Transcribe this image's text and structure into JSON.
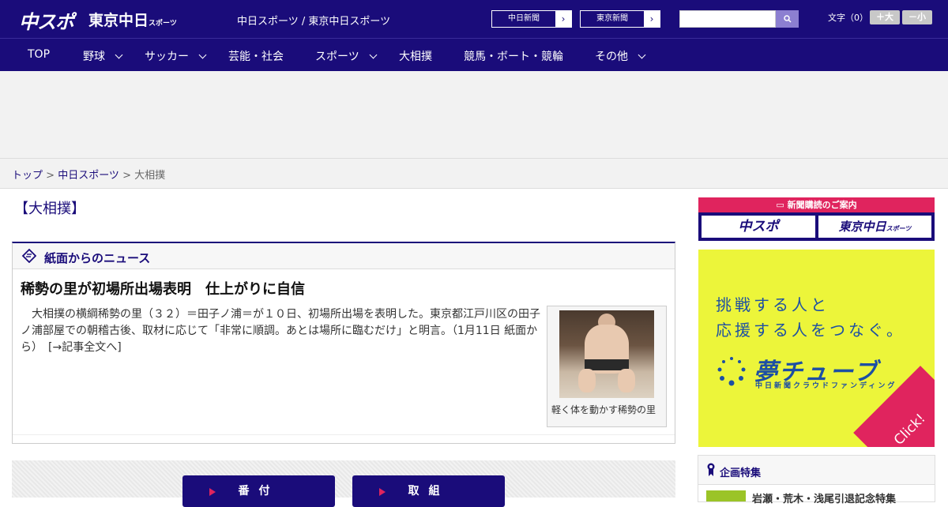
{
  "header": {
    "logo_chunichi": "中スポ",
    "logo_tokyo": "東京中日",
    "logo_tokyo_small": "スポーツ",
    "site_title": "中日スポーツ / 東京中日スポーツ",
    "link_chunichi": "中日新聞",
    "link_tokyo": "東京新聞",
    "search_placeholder": "",
    "fontsize_label": "文字（0）",
    "fontsize_plus": "＋大",
    "fontsize_minus": "－小"
  },
  "nav": {
    "items": [
      {
        "label": "TOP"
      },
      {
        "label": "野球"
      },
      {
        "label": "サッカー"
      },
      {
        "label": "芸能・社会"
      },
      {
        "label": "スポーツ"
      },
      {
        "label": "大相撲"
      },
      {
        "label": "競馬・ボート・競輪"
      },
      {
        "label": "その他"
      }
    ]
  },
  "breadcrumb": {
    "home": "トップ",
    "sep": " > ",
    "parent": "中日スポーツ",
    "current": "大相撲"
  },
  "section_title": "【大相撲】",
  "news": {
    "box_title": "紙面からのニュース",
    "headline": "稀勢の里が初場所出場表明　仕上がりに自信",
    "body": "大相撲の横綱稀勢の里（３２）＝田子ノ浦＝が１０日、初場所出場を表明した。東京都江戸川区の田子ノ浦部屋での朝稽古後、取材に応じて「非常に順調。あとは場所に臨むだけ」と明言。（1月11日 紙面から）　",
    "more_link": "[→記事全文へ]",
    "photo_caption": "軽く体を動かす稀勢の里"
  },
  "bottom_buttons": {
    "banzuke": "番付",
    "torikumi": "取組"
  },
  "sidebar": {
    "subscribe_title": "新聞購読のご案内",
    "subscribe_logo_a": "中スポ",
    "subscribe_logo_b": "東京中日",
    "subscribe_logo_b_small": "スポーツ",
    "ad_line1": "挑戦する人と",
    "ad_line2": "応援する人をつなぐ。",
    "ad_brand": "夢チューブ",
    "ad_brand_sub": "中日新聞クラウドファンディング",
    "ad_click": "Click!",
    "feature_title": "企画特集",
    "feature_item": "岩瀬・荒木・浅尾引退記念特集"
  },
  "colors": {
    "brand_navy": "#1a0c7a",
    "accent_pink": "#e0245e",
    "ad_yellow": "#ecf53a",
    "ad_blue": "#1d4fa3"
  }
}
